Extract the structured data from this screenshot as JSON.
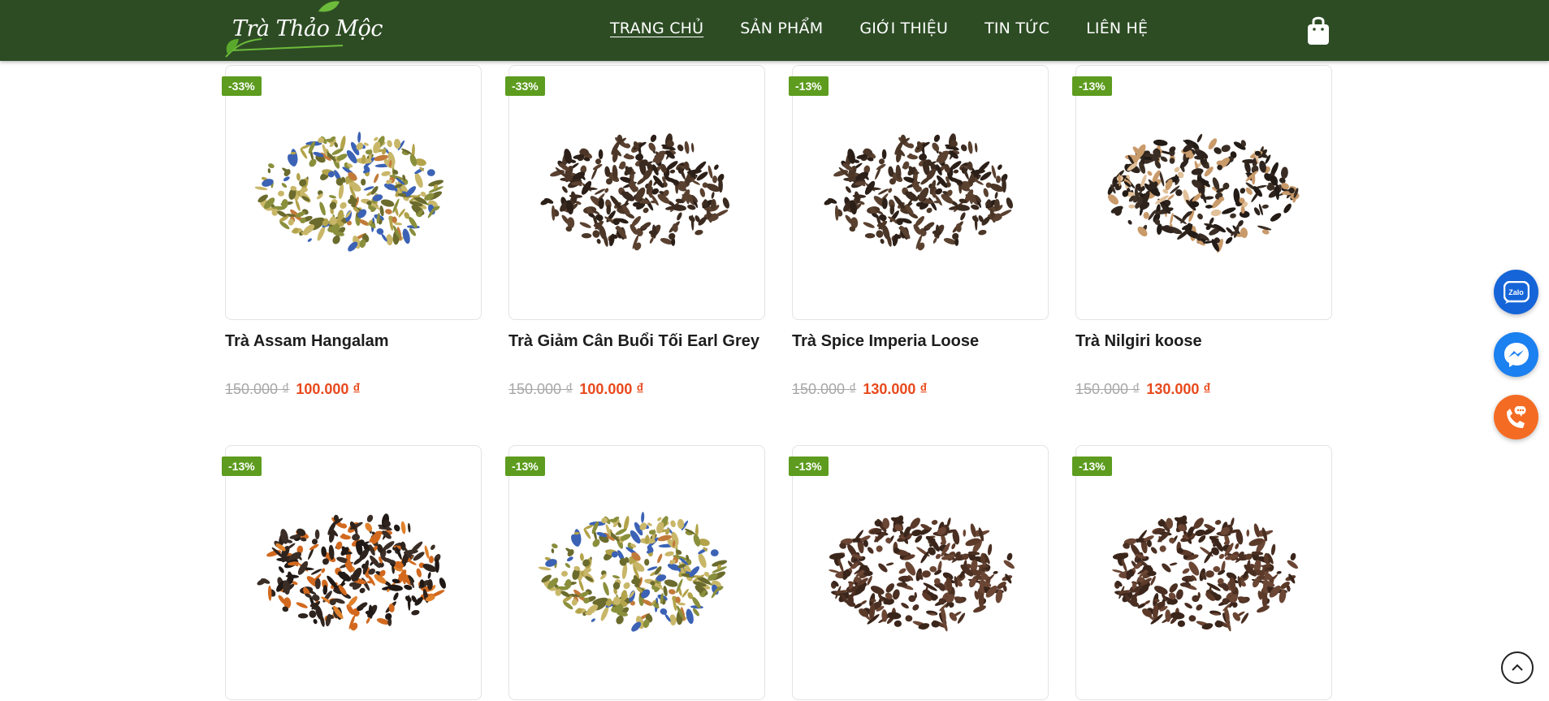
{
  "brand": {
    "logo_text": "Trà Thảo Mộc"
  },
  "nav": {
    "items": [
      {
        "label": "TRANG CHỦ",
        "active": true
      },
      {
        "label": "SẢN PHẨM",
        "active": false
      },
      {
        "label": "GIỚI THIỆU",
        "active": false
      },
      {
        "label": "TIN TỨC",
        "active": false
      },
      {
        "label": "LIÊN HỆ",
        "active": false
      }
    ],
    "cart_icon": "shopping-bag-icon"
  },
  "products": [
    {
      "badge": "-33%",
      "title": "Trà Assam Hangalam",
      "old_price": "150.000 ₫",
      "new_price": "100.000 ₫",
      "image": "mixed-herbal-tea-leaves"
    },
    {
      "badge": "-33%",
      "title": "Trà Giảm Cân Buổi Tối Earl Grey",
      "old_price": "150.000 ₫",
      "new_price": "100.000 ₫",
      "image": "dark-loose-tea-leaves"
    },
    {
      "badge": "-13%",
      "title": "Trà Spice Imperia Loose",
      "old_price": "150.000 ₫",
      "new_price": "130.000 ₫",
      "image": "dark-loose-tea-leaves"
    },
    {
      "badge": "-13%",
      "title": "Trà Nilgiri koose",
      "old_price": "150.000 ₫",
      "new_price": "130.000 ₫",
      "image": "black-tea-with-fruit"
    },
    {
      "badge": "-13%",
      "title": "",
      "old_price": "",
      "new_price": "",
      "image": "black-tea-with-orange"
    },
    {
      "badge": "-13%",
      "title": "",
      "old_price": "",
      "new_price": "",
      "image": "mixed-herbal-tea-leaves"
    },
    {
      "badge": "-13%",
      "title": "",
      "old_price": "",
      "new_price": "",
      "image": "brown-loose-tea-leaves"
    },
    {
      "badge": "-13%",
      "title": "",
      "old_price": "",
      "new_price": "",
      "image": "brown-loose-tea-leaves"
    }
  ],
  "floating": {
    "zalo_label": "Zalo",
    "messenger_icon": "messenger-icon",
    "phone_icon": "phone-icon",
    "scroll_top_icon": "chevron-up-icon"
  },
  "colors": {
    "header_bg": "#2d4c24",
    "badge_bg": "#5d9c1f",
    "sale_price": "#e8491c",
    "old_price": "#a7a7a7"
  }
}
